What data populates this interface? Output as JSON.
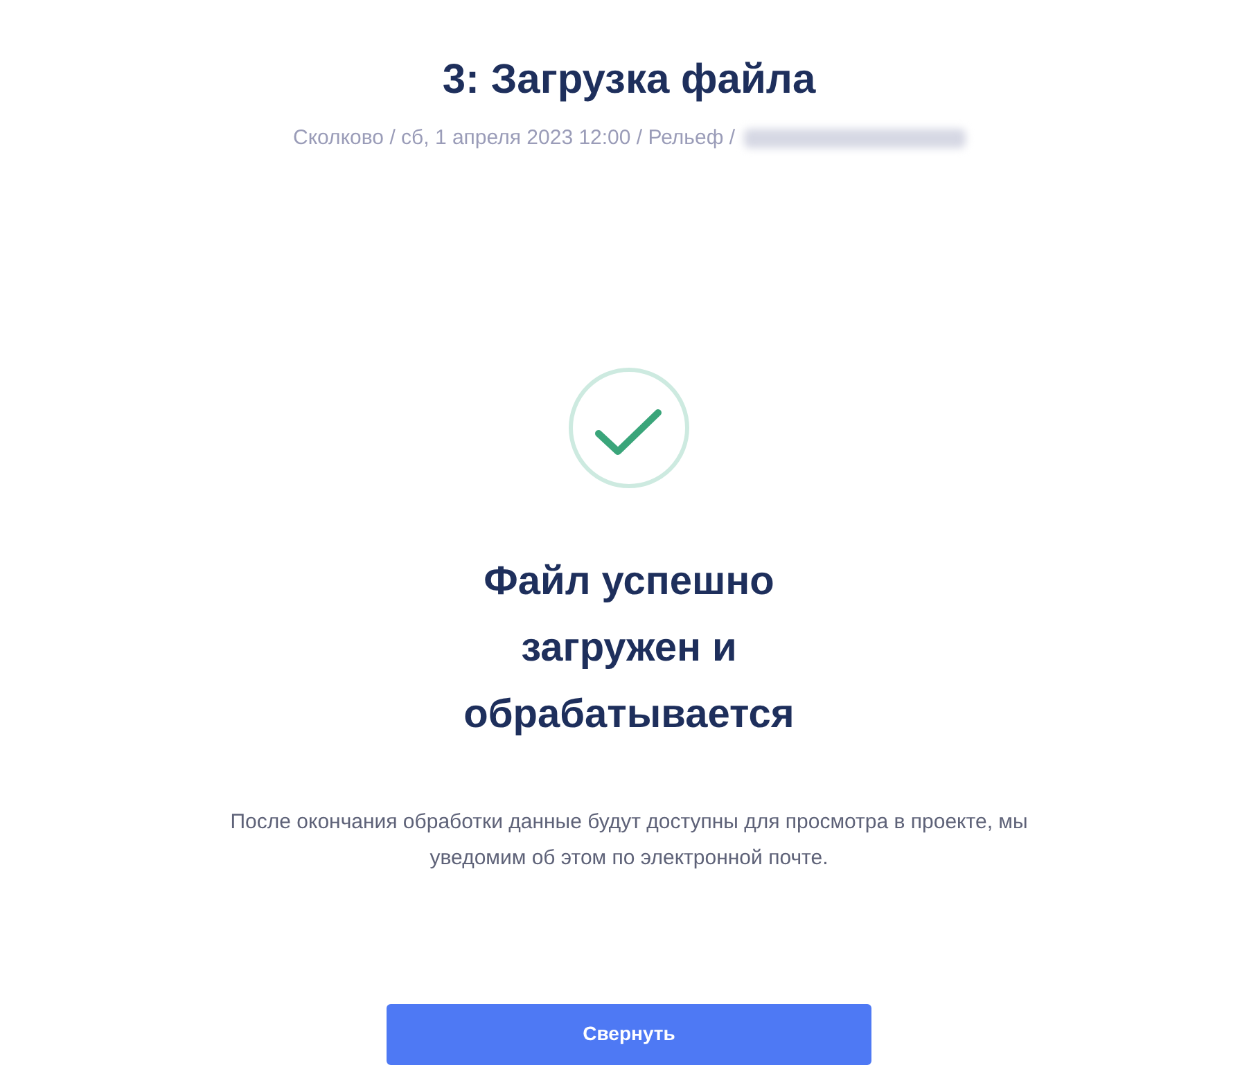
{
  "title": "3: Загрузка файла",
  "breadcrumb": {
    "text": "Сколково / сб, 1 апреля 2023 12:00 / Рельеф /",
    "redacted": true
  },
  "status": {
    "kind": "success",
    "heading": "Файл успешно загружен и обрабатывается",
    "message": "После окончания обработки данные будут доступны для просмотра в проекте, мы уведомим об этом по электронной почте."
  },
  "buttons": [
    "Свернуть"
  ]
}
